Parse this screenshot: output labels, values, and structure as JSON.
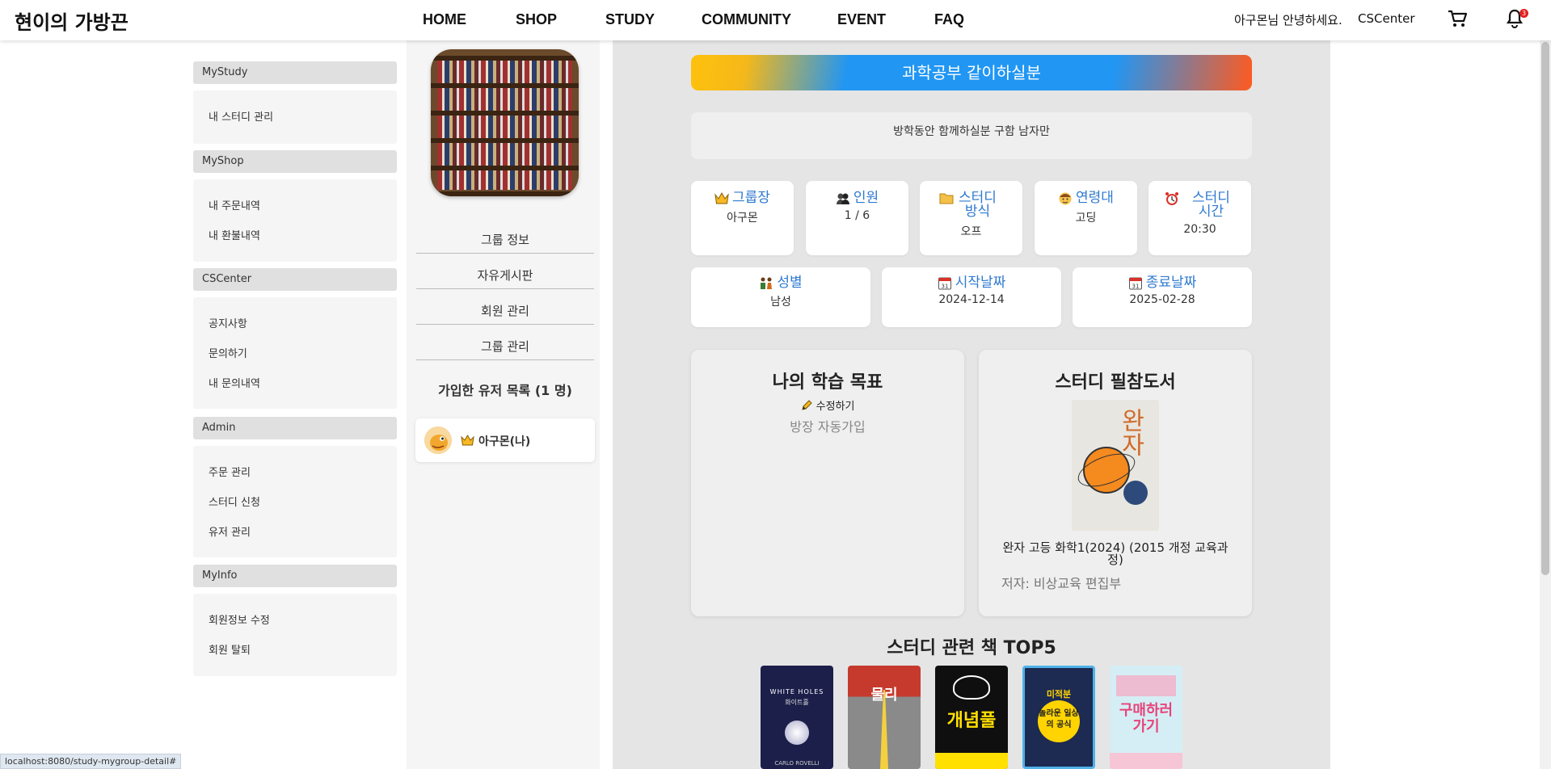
{
  "header": {
    "logo": "현이의 가방끈",
    "nav": [
      "HOME",
      "SHOP",
      "STUDY",
      "COMMUNITY",
      "EVENT",
      "FAQ"
    ],
    "greeting": "아구몬님 안녕하세요.",
    "cs_link": "CSCenter",
    "notification_count": "3"
  },
  "left_menu": [
    {
      "title": "MyStudy",
      "items": [
        "내 스터디 관리"
      ]
    },
    {
      "title": "MyShop",
      "items": [
        "내 주문내역",
        "내 환불내역"
      ]
    },
    {
      "title": "CSCenter",
      "items": [
        "공지사항",
        "문의하기",
        "내 문의내역"
      ]
    },
    {
      "title": "Admin",
      "items": [
        "주문 관리",
        "스터디 신청",
        "유저 관리"
      ]
    },
    {
      "title": "MyInfo",
      "items": [
        "회원정보 수정",
        "회원 탈퇴"
      ]
    }
  ],
  "middle": {
    "menu": [
      "그룹 정보",
      "자유게시판",
      "회원 관리",
      "그룹 관리"
    ],
    "member_list_title": "가입한 유저 목록 (1 명)",
    "members": [
      {
        "name": "아구몬(나)"
      }
    ]
  },
  "main": {
    "banner": "과학공부 같이하실분",
    "description": "방학동안 함께하실분 구함 남자만",
    "info_row1": [
      {
        "label": "그룹장",
        "value": "아구몬",
        "icon": "crown-icon"
      },
      {
        "label": "인원",
        "value": "1 / 6",
        "icon": "people-icon"
      },
      {
        "label": "스터디 방식",
        "value": "오프",
        "icon": "folder-icon"
      },
      {
        "label": "연령대",
        "value": "고딩",
        "icon": "face-icon"
      },
      {
        "label": "스터디 시간",
        "value": "20:30",
        "icon": "alarm-clock-icon"
      }
    ],
    "info_row2": [
      {
        "label": "성별",
        "value": "남성",
        "icon": "couple-icon"
      },
      {
        "label": "시작날짜",
        "value": "2024-12-14",
        "icon": "calendar-icon"
      },
      {
        "label": "종료날짜",
        "value": "2025-02-28",
        "icon": "calendar-icon"
      }
    ],
    "goal": {
      "title": "나의 학습 목표",
      "edit_label": "수정하기",
      "text": "방장 자동가입"
    },
    "book": {
      "title": "스터디 필참도서",
      "name": "완자 고등 화학1(2024) (2015 개정 교육과정)",
      "author": "저자: 비상교육 편집부"
    },
    "top5_title": "스터디 관련 책 TOP5",
    "top5": [
      {
        "cover_text": "WHITE HOLES",
        "sub": "화이트홀",
        "bottom": "CARLO ROVELLI",
        "bg": "#1c1f4a"
      },
      {
        "cover_text": "물리",
        "sub": "",
        "bottom": "",
        "bg": "#c63a2d"
      },
      {
        "cover_text": "개념풀",
        "sub": "",
        "bottom": "",
        "bg": "#0f0f0f"
      },
      {
        "cover_text": "놀라운 일상의 공식",
        "sub": "미적분",
        "bottom": "",
        "bg": "#1d2a52"
      },
      {
        "cover_text": "구매하러 가기",
        "sub": "",
        "bottom": "",
        "bg": "#d5eef5"
      }
    ]
  },
  "status_url": "localhost:8080/study-mygroup-detail#"
}
